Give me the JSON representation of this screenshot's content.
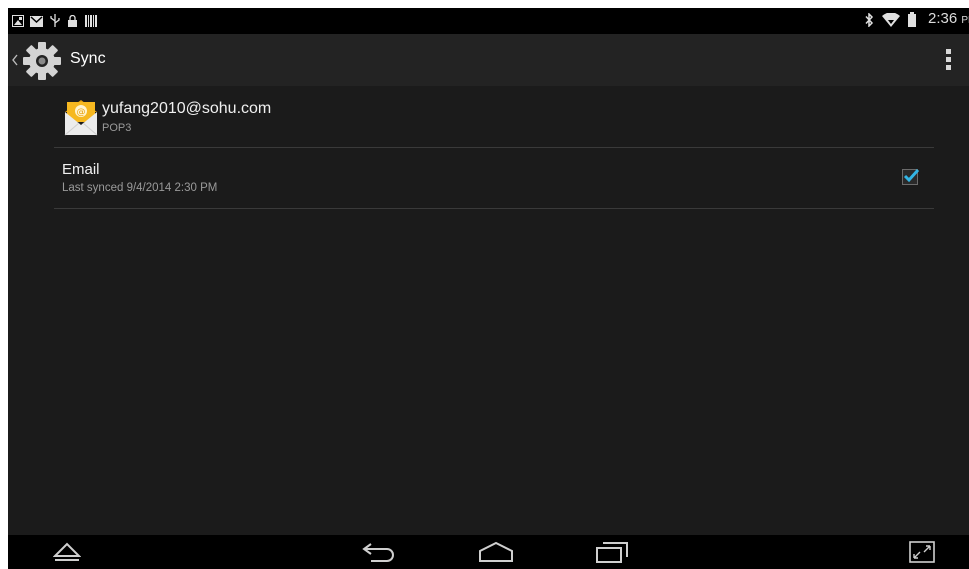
{
  "status_bar": {
    "icons_left": [
      "image-icon",
      "gmail-icon",
      "usb-icon",
      "lock-icon",
      "barcode-icon"
    ],
    "icons_right": [
      "bluetooth-icon",
      "wifi-icon",
      "battery-icon"
    ],
    "time": "2:36",
    "ampm": "PM"
  },
  "action_bar": {
    "title": "Sync",
    "app_icon": "settings-gear-icon"
  },
  "account": {
    "name": "yufang2010@sohu.com",
    "type": "POP3"
  },
  "sync_item": {
    "title": "Email",
    "last_synced": "Last synced 9/4/2014 2:30 PM",
    "checked": true
  },
  "nav_bar": {
    "buttons": [
      "hide-nav-icon",
      "back-icon",
      "home-icon",
      "recents-icon",
      "fullscreen-icon"
    ]
  },
  "colors": {
    "accent": "#33b5e5",
    "email_icon": "#f2b01e",
    "background": "#1b1b1b",
    "action_bar": "#232323"
  }
}
